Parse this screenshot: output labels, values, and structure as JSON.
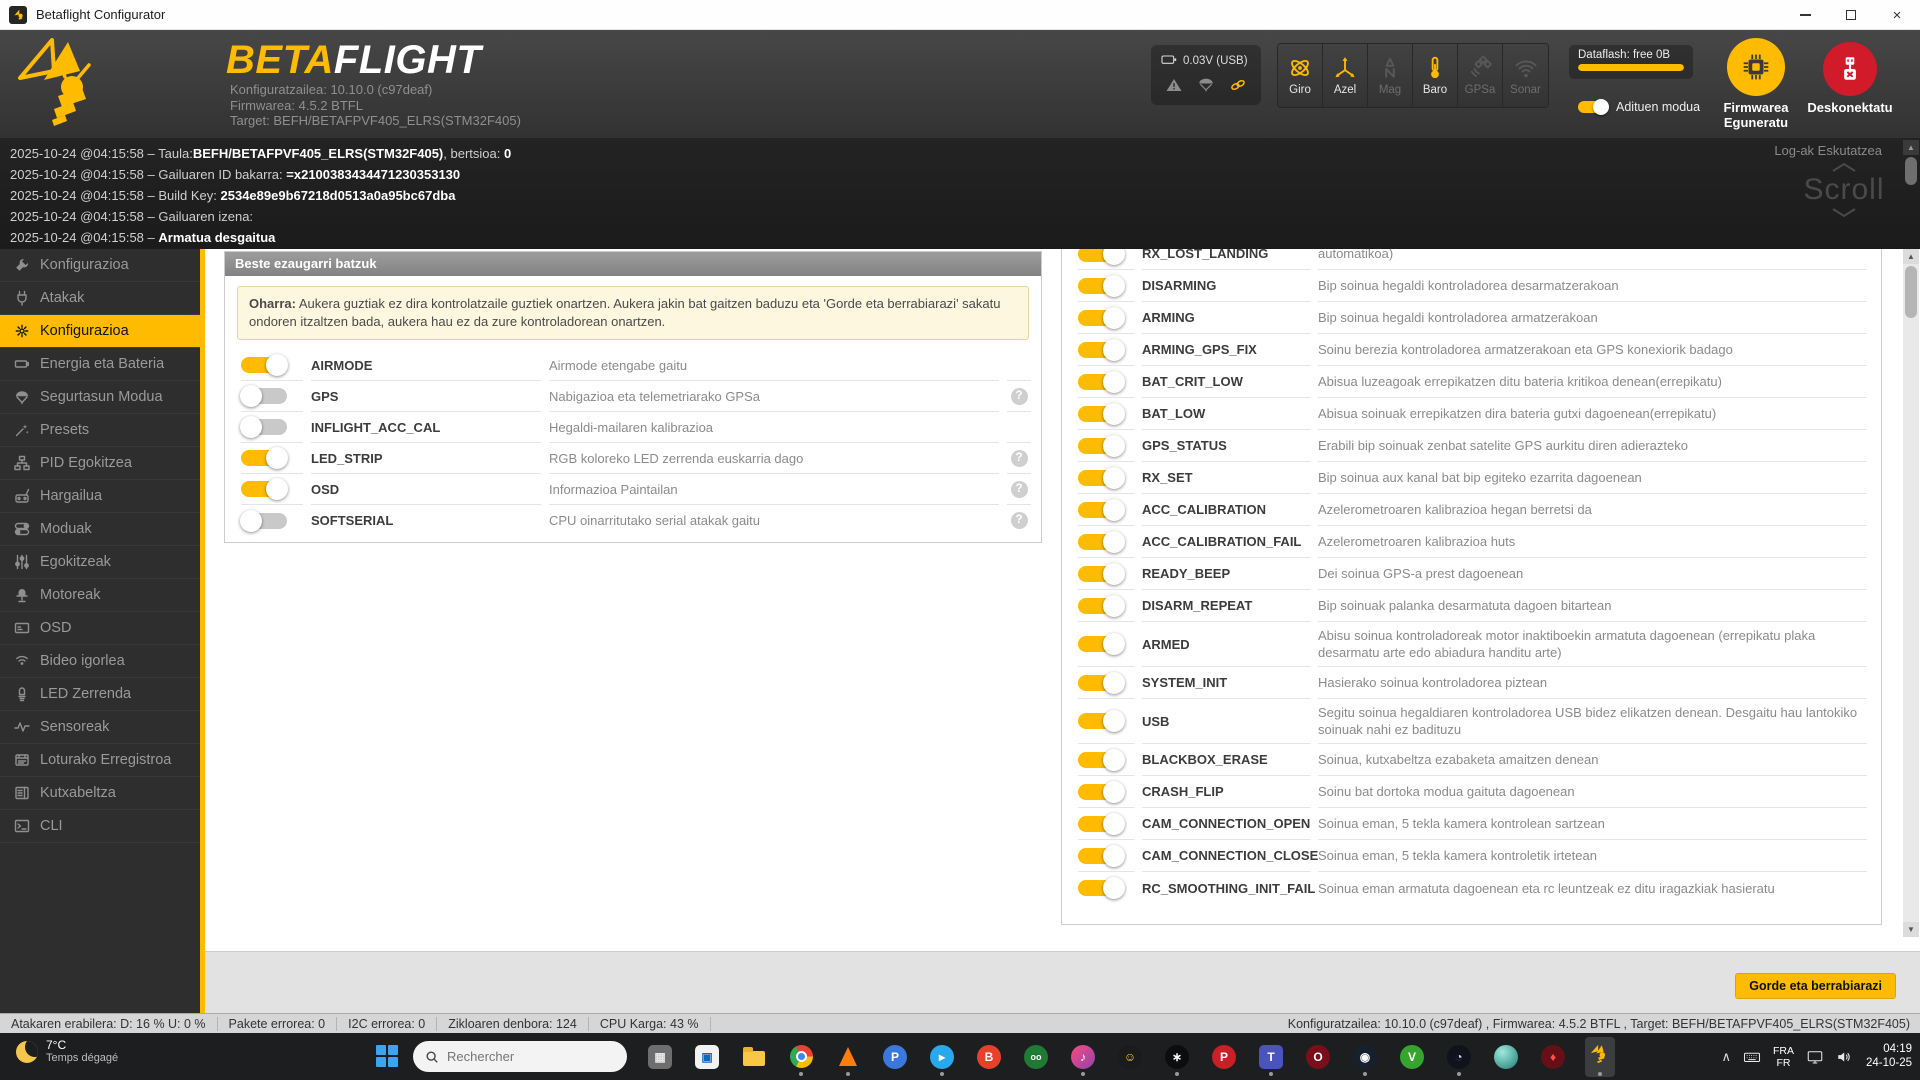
{
  "window": {
    "title": "Betaflight Configurator"
  },
  "header": {
    "brand_beta": "BETA",
    "brand_flight": "FLIGHT",
    "version_lines": [
      "Konfiguratzailea: 10.10.0 (c97deaf)",
      "Firmwarea: 4.5.2 BTFL",
      "Target: BEFH/BETAFPVF405_ELRS(STM32F405)"
    ],
    "battery_voltage": "0.03V (USB)",
    "accent_color": "#ffbb00",
    "sensors": [
      {
        "label": "Giro",
        "icon": "gyro",
        "active": true
      },
      {
        "label": "Azel",
        "icon": "accel",
        "active": true
      },
      {
        "label": "Mag",
        "icon": "mag",
        "active": false
      },
      {
        "label": "Baro",
        "icon": "baro",
        "active": true
      },
      {
        "label": "GPSa",
        "icon": "gps",
        "active": false
      },
      {
        "label": "Sonar",
        "icon": "sonar",
        "active": false
      }
    ],
    "dataflash_label": "Dataflash: free 0B",
    "dataflash_fill_pct": 100,
    "expert_mode_label": "Adituen modua",
    "expert_mode_on": true,
    "update_button_label": "Firmwarea Eguneratu",
    "disconnect_button_label": "Deskonektatu"
  },
  "log": {
    "lines": [
      [
        {
          "t": "2025-10-24 @04:15:58 – Taula:"
        },
        {
          "t": "BEFH/BETAFPVF405_ELRS(STM32F405)",
          "b": 1
        },
        {
          "t": ", bertsioa: "
        },
        {
          "t": "0",
          "b": 1
        }
      ],
      [
        {
          "t": "2025-10-24 @04:15:58 – Gailuaren ID bakarra: "
        },
        {
          "t": "=x2100383434471230353130",
          "b": 1
        }
      ],
      [
        {
          "t": "2025-10-24 @04:15:58 – Build Key: "
        },
        {
          "t": "2534e89e9b67218d0513a0a95bc67dba",
          "b": 1
        }
      ],
      [
        {
          "t": "2025-10-24 @04:15:58 – Gailuaren izena:"
        }
      ],
      [
        {
          "t": "2025-10-24 @04:15:58 – "
        },
        {
          "t": "Armatua desgaitua",
          "b": 1
        }
      ]
    ],
    "hide_logs_label": "Log-ak Eskutatzea",
    "scroll_label": "Scroll"
  },
  "sidebar": {
    "items": [
      {
        "label": "Konfigurazioa",
        "icon": "wrench",
        "active": false
      },
      {
        "label": "Atakak",
        "icon": "plug",
        "active": false
      },
      {
        "label": "Konfigurazioa",
        "icon": "gear",
        "active": true
      },
      {
        "label": "Energia eta Bateria",
        "icon": "battery",
        "active": false
      },
      {
        "label": "Segurtasun Modua",
        "icon": "parachute",
        "active": false
      },
      {
        "label": "Presets",
        "icon": "wand",
        "active": false
      },
      {
        "label": "PID Egokitzea",
        "icon": "sitemap",
        "active": false
      },
      {
        "label": "Hargailua",
        "icon": "receiver",
        "active": false
      },
      {
        "label": "Moduak",
        "icon": "modes",
        "active": false
      },
      {
        "label": "Egokitzeak",
        "icon": "sliders",
        "active": false
      },
      {
        "label": "Motoreak",
        "icon": "motor",
        "active": false
      },
      {
        "label": "OSD",
        "icon": "osd",
        "active": false
      },
      {
        "label": "Bideo igorlea",
        "icon": "vtx",
        "active": false
      },
      {
        "label": "LED Zerrenda",
        "icon": "led",
        "active": false
      },
      {
        "label": "Sensoreak",
        "icon": "pulse",
        "active": false
      },
      {
        "label": "Loturako Erregistroa",
        "icon": "logbook",
        "active": false
      },
      {
        "label": "Kutxabeltza",
        "icon": "blackbox",
        "active": false
      },
      {
        "label": "CLI",
        "icon": "terminal",
        "active": false
      }
    ]
  },
  "features_panel": {
    "title": "Beste ezaugarri batzuk",
    "note_bold": "Oharra:",
    "note_rest": " Aukera guztiak ez dira kontrolatzaile guztiek onartzen. Aukera jakin bat gaitzen baduzu eta 'Gorde eta berrabiarazi' sakatu ondoren itzaltzen bada, aukera hau ez da zure kontroladorean onartzen.",
    "rows": [
      {
        "name": "AIRMODE",
        "desc": "Airmode etengabe gaitu",
        "on": true,
        "help": false
      },
      {
        "name": "GPS",
        "desc": "Nabigazioa eta telemetriarako GPSa",
        "on": false,
        "help": true
      },
      {
        "name": "INFLIGHT_ACC_CAL",
        "desc": "Hegaldi-mailaren kalibrazioa",
        "on": false,
        "help": false
      },
      {
        "name": "LED_STRIP",
        "desc": "RGB koloreko LED zerrenda euskarria dago",
        "on": true,
        "help": true
      },
      {
        "name": "OSD",
        "desc": "Informazioa Paintailan",
        "on": true,
        "help": true
      },
      {
        "name": "SOFTSERIAL",
        "desc": "CPU oinarritutako serial atakak gaitu",
        "on": false,
        "help": true
      }
    ]
  },
  "beeper_panel": {
    "rows": [
      {
        "name": "RX_LOST_LANDING",
        "desc": "automatikoa)",
        "on": true,
        "clipped": true
      },
      {
        "name": "DISARMING",
        "desc": "Bip soinua hegaldi kontroladorea desarmatzerakoan",
        "on": true
      },
      {
        "name": "ARMING",
        "desc": "Bip soinua hegaldi kontroladorea armatzerakoan",
        "on": true
      },
      {
        "name": "ARMING_GPS_FIX",
        "desc": "Soinu berezia kontroladorea armatzerakoan eta GPS konexiorik badago",
        "on": true
      },
      {
        "name": "BAT_CRIT_LOW",
        "desc": "Abisua luzeagoak errepikatzen ditu bateria kritikoa denean(errepikatu)",
        "on": true
      },
      {
        "name": "BAT_LOW",
        "desc": "Abisua soinuak errepikatzen dira bateria gutxi dagoenean(errepikatu)",
        "on": true
      },
      {
        "name": "GPS_STATUS",
        "desc": "Erabili bip soinuak zenbat satelite GPS aurkitu diren adierazteko",
        "on": true
      },
      {
        "name": "RX_SET",
        "desc": "Bip soinua aux kanal bat bip egiteko ezarrita dagoenean",
        "on": true
      },
      {
        "name": "ACC_CALIBRATION",
        "desc": "Azelerometroaren kalibrazioa hegan berretsi da",
        "on": true
      },
      {
        "name": "ACC_CALIBRATION_FAIL",
        "desc": "Azelerometroaren kalibrazioa huts",
        "on": true
      },
      {
        "name": "READY_BEEP",
        "desc": "Dei soinua GPS-a prest dagoenean",
        "on": true
      },
      {
        "name": "DISARM_REPEAT",
        "desc": "Bip soinuak palanka desarmatuta dagoen bitartean",
        "on": true
      },
      {
        "name": "ARMED",
        "desc": "Abisu soinua kontroladoreak motor inaktiboekin armatuta dagoenean (errepikatu plaka desarmatu arte edo abiadura handitu arte)",
        "on": true
      },
      {
        "name": "SYSTEM_INIT",
        "desc": "Hasierako soinua kontroladorea piztean",
        "on": true
      },
      {
        "name": "USB",
        "desc": "Segitu soinua hegaldiaren kontroladorea USB bidez elikatzen denean. Desgaitu hau lantokiko soinuak nahi ez badituzu",
        "on": true
      },
      {
        "name": "BLACKBOX_ERASE",
        "desc": "Soinua, kutxabeltza ezabaketa amaitzen denean",
        "on": true
      },
      {
        "name": "CRASH_FLIP",
        "desc": "Soinu bat dortoka modua gaituta dagoenean",
        "on": true
      },
      {
        "name": "CAM_CONNECTION_OPEN",
        "desc": "Soinua eman, 5 tekla kamera kontrolean sartzean",
        "on": true
      },
      {
        "name": "CAM_CONNECTION_CLOSE",
        "desc": "Soinua eman, 5 tekla kamera kontroletik irtetean",
        "on": true
      },
      {
        "name": "RC_SMOOTHING_INIT_FAIL",
        "desc": "Soinua eman armatuta dagoenean eta rc leuntzeak ez ditu iragazkiak hasieratu",
        "on": true
      }
    ]
  },
  "footer": {
    "save_button_label": "Gorde eta berrabiarazi"
  },
  "statusbar": {
    "cells": [
      "Atakaren erabilera: D: 16 % U: 0 %",
      "Pakete errorea: 0",
      "I2C errorea: 0",
      "Zikloaren denbora: 124",
      "CPU Karga: 43 %"
    ],
    "right": "Konfiguratzailea: 10.10.0 (c97deaf) , Firmwarea: 4.5.2 BTFL , Target: BEFH/BETAFPVF405_ELRS(STM32F405)"
  },
  "taskbar": {
    "weather_temp": "7°C",
    "weather_desc": "Temps dégagé",
    "search_placeholder": "Rechercher",
    "language_top": "FRA",
    "language_bottom": "FR",
    "clock_time": "04:19",
    "clock_date": "24-10-25",
    "apps": [
      {
        "name": "widgets-app",
        "shape": "square",
        "bg": "#6e6e6e",
        "fg": "#e8e8e8",
        "glyph": "▦"
      },
      {
        "name": "microsoft-store",
        "shape": "square",
        "bg": "#f2f2f2",
        "fg": "#0b68c9",
        "glyph": "▣"
      },
      {
        "name": "file-explorer",
        "shape": "folder"
      },
      {
        "name": "chrome",
        "shape": "chrome",
        "running": true
      },
      {
        "name": "vlc",
        "shape": "cone",
        "running": true
      },
      {
        "name": "paint-app",
        "shape": "circle",
        "bg": "#3b78dd",
        "glyph": "P"
      },
      {
        "name": "telegram",
        "shape": "circle",
        "bg": "#29a9eb",
        "glyph": "▸",
        "running": true
      },
      {
        "name": "brave",
        "shape": "circle",
        "bg": "#e8402a",
        "glyph": "B"
      },
      {
        "name": "green-app",
        "shape": "circle",
        "bg": "#1f7a33",
        "glyph": "oo"
      },
      {
        "name": "music-app",
        "shape": "circle",
        "bg": "linear-gradient(135deg,#fc4a7e,#8e44ad)",
        "glyph": "♪",
        "running": true
      },
      {
        "name": "emoji-app",
        "shape": "circle",
        "bg": "#1b1b1b",
        "fg": "#ffd43b",
        "glyph": "☺"
      },
      {
        "name": "chatgpt-app",
        "shape": "circle",
        "bg": "#0d0d0d",
        "glyph": "∗",
        "running": true
      },
      {
        "name": "pinterest-app",
        "shape": "circle",
        "bg": "#cb1f27",
        "glyph": "P"
      },
      {
        "name": "teams-app",
        "shape": "square",
        "bg": "#4b53bc",
        "glyph": "T",
        "running": true
      },
      {
        "name": "opera-app",
        "shape": "circle",
        "bg": "#7a0f1b",
        "glyph": "O"
      },
      {
        "name": "steam-app",
        "shape": "circle",
        "bg": "#17202e",
        "glyph": "◉",
        "running": true
      },
      {
        "name": "green-v-app",
        "shape": "circle",
        "bg": "#35a52f",
        "glyph": "V"
      },
      {
        "name": "clock-app",
        "shape": "circle",
        "bg": "#11131c",
        "fg": "#cdd6ff",
        "glyph": "◔",
        "running": true
      },
      {
        "name": "sphere-app",
        "shape": "circle",
        "bg": "radial-gradient(circle at 35% 30%,#9fe8dd,#1e7d74)",
        "glyph": ""
      },
      {
        "name": "darkred-app",
        "shape": "circle",
        "bg": "#641016",
        "fg": "#ff4d4d",
        "glyph": "♦"
      },
      {
        "name": "betaflight-app",
        "shape": "bee",
        "active": true,
        "running": true
      }
    ]
  }
}
